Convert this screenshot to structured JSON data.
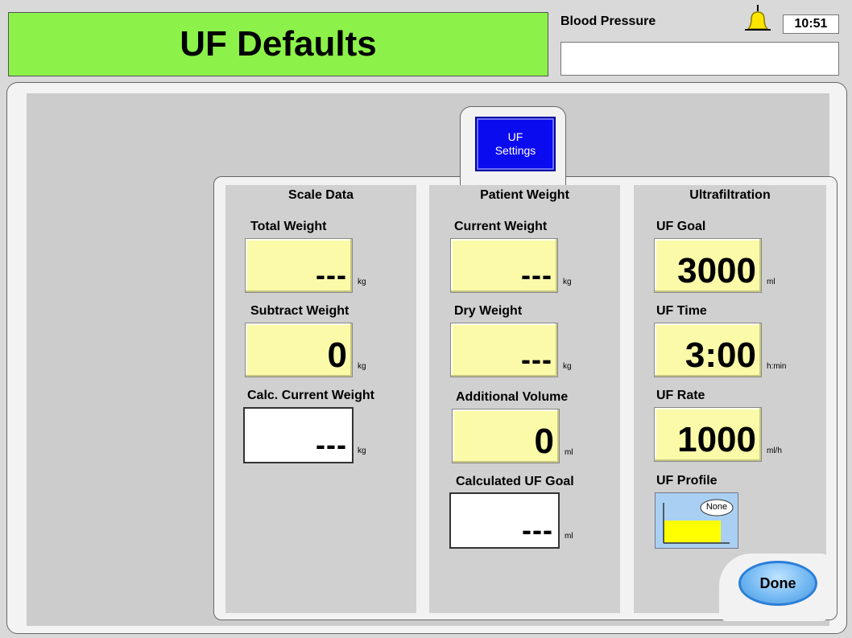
{
  "header": {
    "title": "UF Defaults",
    "bp_label": "Blood Pressure",
    "bp_value": "",
    "time": "10:51",
    "alarm_icon": "bell-icon"
  },
  "tab": {
    "line1": "UF",
    "line2": "Settings"
  },
  "scale": {
    "title": "Scale Data",
    "total_label": "Total Weight",
    "total_value": "---",
    "total_unit": "kg",
    "subtract_label": "Subtract Weight",
    "subtract_value": "0",
    "subtract_unit": "kg",
    "calc_label": "Calc. Current Weight",
    "calc_value": "---",
    "calc_unit": "kg"
  },
  "patient": {
    "title": "Patient Weight",
    "current_label": "Current Weight",
    "current_value": "---",
    "current_unit": "kg",
    "dry_label": "Dry Weight",
    "dry_value": "---",
    "dry_unit": "kg",
    "addvol_label": "Additional Volume",
    "addvol_value": "0",
    "addvol_unit": "ml",
    "calcgoal_label": "Calculated UF Goal",
    "calcgoal_value": "---",
    "calcgoal_unit": "ml"
  },
  "uf": {
    "title": "Ultrafiltration",
    "goal_label": "UF Goal",
    "goal_value": "3000",
    "goal_unit": "ml",
    "time_label": "UF Time",
    "time_value": "3:00",
    "time_unit": "h:min",
    "rate_label": "UF Rate",
    "rate_value": "1000",
    "rate_unit": "ml/h",
    "profile_label": "UF Profile",
    "profile_value": "None"
  },
  "done_label": "Done",
  "colors": {
    "title_bg": "#8cf24a",
    "field_bg": "#fafaa8",
    "tab_button": "#0b0bf0",
    "done_button": "#6fb6f2"
  }
}
